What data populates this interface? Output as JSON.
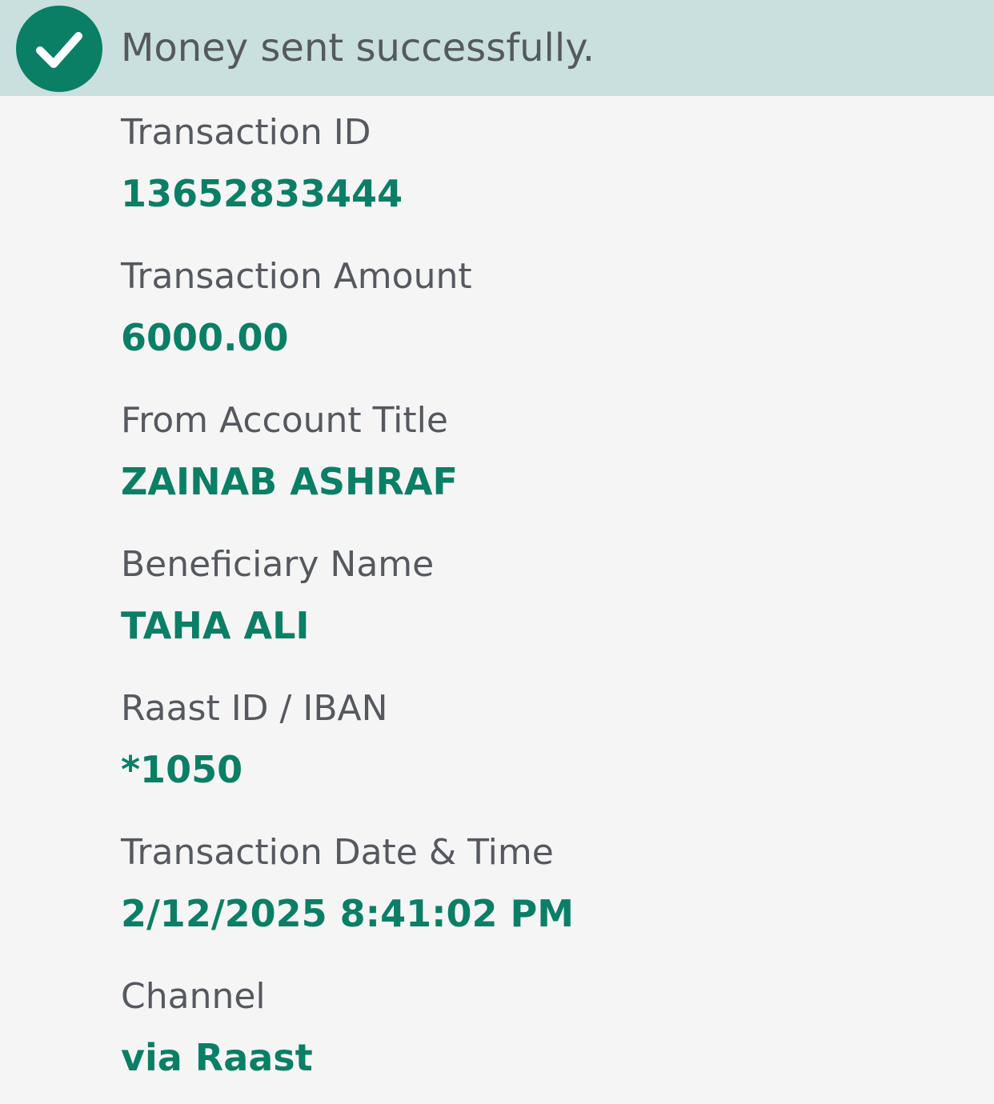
{
  "banner": {
    "message": "Money sent successfully.",
    "icon": "check-icon",
    "color": "#0a7f66",
    "background": "#c9e0de"
  },
  "details": [
    {
      "label": "Transaction ID",
      "value": "13652833444"
    },
    {
      "label": "Transaction Amount",
      "value": "6000.00"
    },
    {
      "label": "From Account Title",
      "value": "ZAINAB ASHRAF"
    },
    {
      "label": "Beneficiary Name",
      "value": "TAHA ALI"
    },
    {
      "label": "Raast ID / IBAN",
      "value": "*1050"
    },
    {
      "label": "Transaction Date & Time",
      "value": "2/12/2025 8:41:02 PM"
    },
    {
      "label": "Channel",
      "value": "via Raast"
    }
  ],
  "colors": {
    "label": "#55595f",
    "value": "#0a7f66",
    "page_background": "#f5f5f5"
  }
}
